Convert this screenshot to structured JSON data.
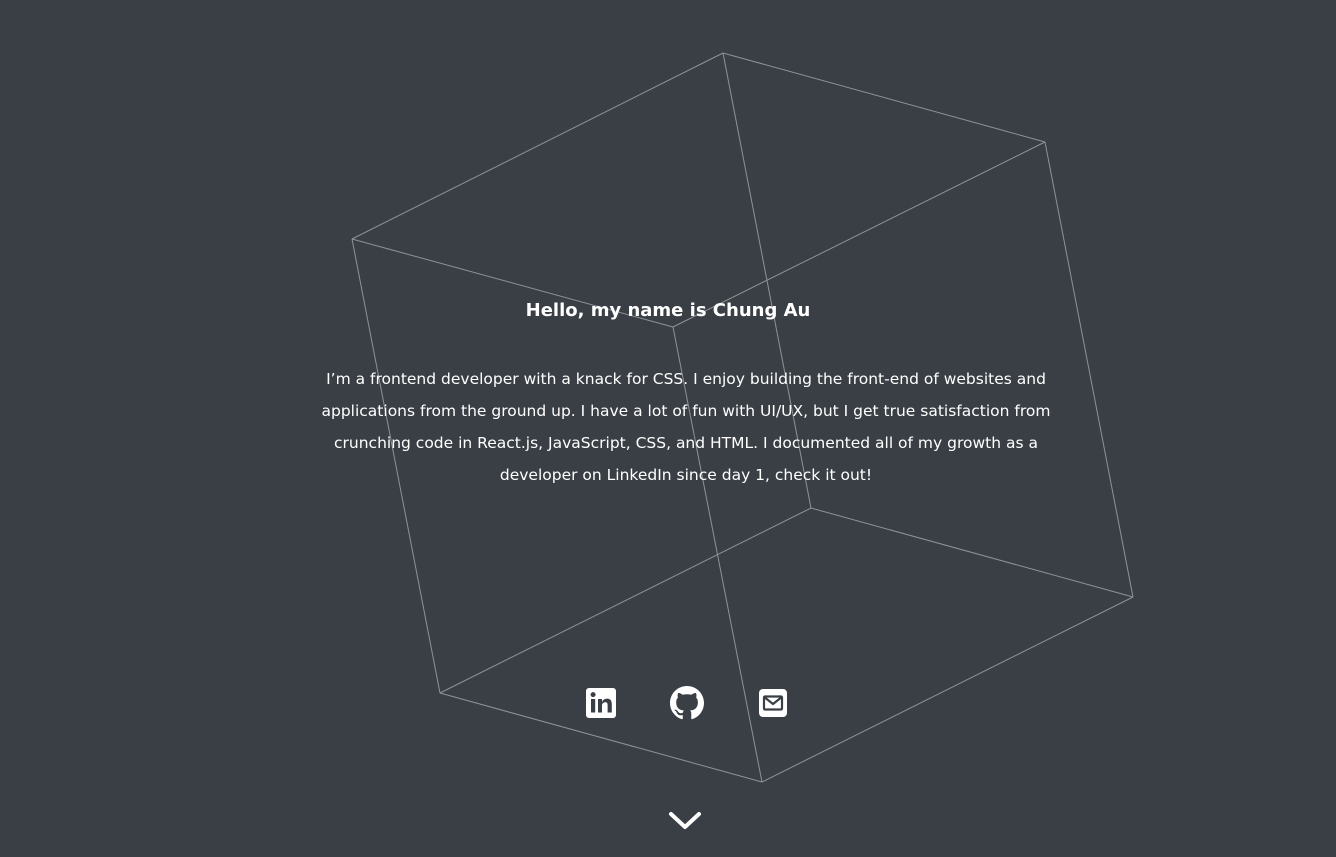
{
  "hero": {
    "heading": "Hello, my name is Chung Au",
    "bio": "I’m a frontend developer with a knack for CSS. I enjoy building the front-end of websites and\napplications from the ground up. I have a lot of fun with UI/UX, but I get true satisfaction from\ncrunching code in React.js, JavaScript, CSS, and HTML. I documented all of my growth as a\ndeveloper on LinkedIn since day 1, check it out!"
  },
  "socials": [
    {
      "icon": "linkedin-icon"
    },
    {
      "icon": "github-icon"
    },
    {
      "icon": "envelope-icon"
    }
  ],
  "scroll": {
    "icon": "chevron-down-icon"
  },
  "colors": {
    "background": "#393f44",
    "text": "#ffffff",
    "cube_wireframe": "#8e9396"
  }
}
